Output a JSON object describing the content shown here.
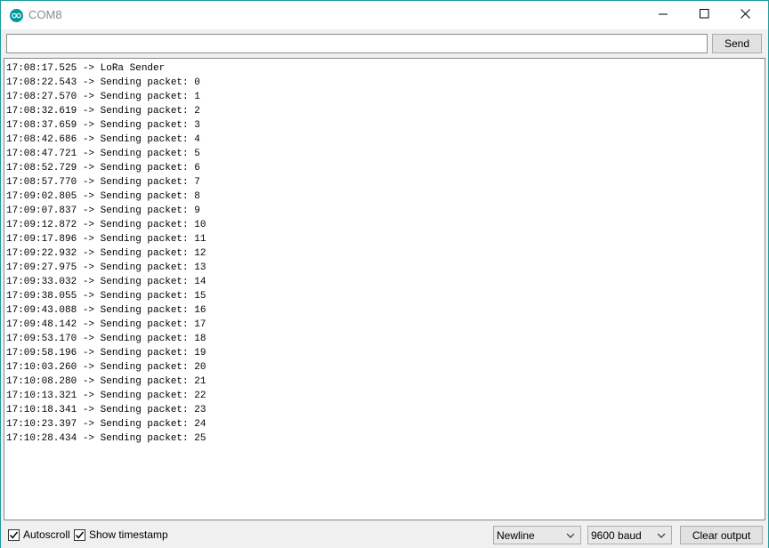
{
  "window": {
    "title": "COM8"
  },
  "send_bar": {
    "input_value": "",
    "send_label": "Send"
  },
  "output_lines": [
    "17:08:17.525 -> LoRa Sender",
    "17:08:22.543 -> Sending packet: 0",
    "17:08:27.570 -> Sending packet: 1",
    "17:08:32.619 -> Sending packet: 2",
    "17:08:37.659 -> Sending packet: 3",
    "17:08:42.686 -> Sending packet: 4",
    "17:08:47.721 -> Sending packet: 5",
    "17:08:52.729 -> Sending packet: 6",
    "17:08:57.770 -> Sending packet: 7",
    "17:09:02.805 -> Sending packet: 8",
    "17:09:07.837 -> Sending packet: 9",
    "17:09:12.872 -> Sending packet: 10",
    "17:09:17.896 -> Sending packet: 11",
    "17:09:22.932 -> Sending packet: 12",
    "17:09:27.975 -> Sending packet: 13",
    "17:09:33.032 -> Sending packet: 14",
    "17:09:38.055 -> Sending packet: 15",
    "17:09:43.088 -> Sending packet: 16",
    "17:09:48.142 -> Sending packet: 17",
    "17:09:53.170 -> Sending packet: 18",
    "17:09:58.196 -> Sending packet: 19",
    "17:10:03.260 -> Sending packet: 20",
    "17:10:08.280 -> Sending packet: 21",
    "17:10:13.321 -> Sending packet: 22",
    "17:10:18.341 -> Sending packet: 23",
    "17:10:23.397 -> Sending packet: 24",
    "17:10:28.434 -> Sending packet: 25"
  ],
  "status_bar": {
    "autoscroll": {
      "label": "Autoscroll",
      "checked": true
    },
    "show_timestamp": {
      "label": "Show timestamp",
      "checked": true
    },
    "line_ending": {
      "selected": "Newline"
    },
    "baud_rate": {
      "selected": "9600 baud"
    },
    "clear_label": "Clear output"
  },
  "colors": {
    "accent": "#1d9b9b",
    "icon_teal": "#00979d"
  },
  "icons": {
    "app": "arduino-icon",
    "minimize": "minimize-icon",
    "maximize": "maximize-icon",
    "close": "close-icon",
    "check": "checkmark-icon",
    "caret": "chevron-down-icon"
  }
}
